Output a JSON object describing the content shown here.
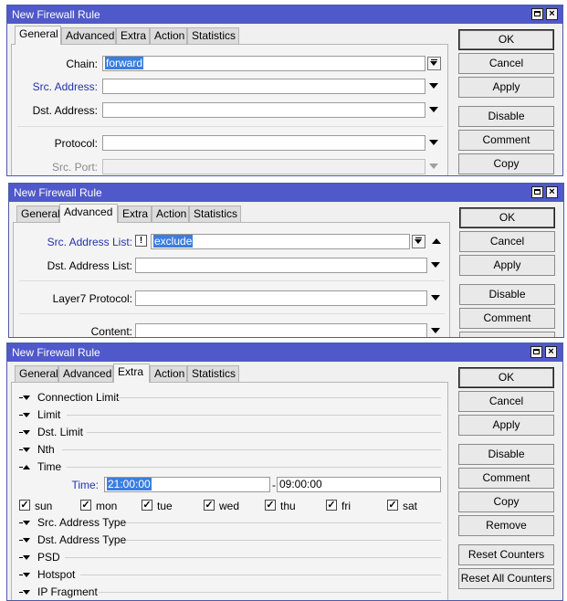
{
  "window1": {
    "title": "New Firewall Rule",
    "tabs": [
      "General",
      "Advanced",
      "Extra",
      "Action",
      "Statistics"
    ],
    "active_tab": "General",
    "fields": {
      "chain_label": "Chain:",
      "chain_value": "forward",
      "src_address_label": "Src. Address:",
      "src_address_value": "",
      "dst_address_label": "Dst. Address:",
      "dst_address_value": "",
      "protocol_label": "Protocol:",
      "protocol_value": "",
      "src_port_label": "Src. Port:",
      "src_port_value": ""
    },
    "buttons": [
      "OK",
      "Cancel",
      "Apply",
      "Disable",
      "Comment",
      "Copy"
    ]
  },
  "window2": {
    "title": "New Firewall Rule",
    "tabs": [
      "General",
      "Advanced",
      "Extra",
      "Action",
      "Statistics"
    ],
    "active_tab": "Advanced",
    "fields": {
      "src_address_list_label": "Src. Address List:",
      "src_address_list_not": "!",
      "src_address_list_value": "exclude",
      "dst_address_list_label": "Dst. Address List:",
      "dst_address_list_value": "",
      "layer7_label": "Layer7 Protocol:",
      "layer7_value": "",
      "content_label": "Content:",
      "content_value": ""
    },
    "buttons": [
      "OK",
      "Cancel",
      "Apply",
      "Disable",
      "Comment"
    ]
  },
  "window3": {
    "title": "New Firewall Rule",
    "tabs": [
      "General",
      "Advanced",
      "Extra",
      "Action",
      "Statistics"
    ],
    "active_tab": "Extra",
    "sections_top": [
      "Connection Limit",
      "Limit",
      "Dst. Limit",
      "Nth"
    ],
    "time_section": "Time",
    "time_label": "Time:",
    "time_from": "21:00:00",
    "time_separator": "-",
    "time_to": "09:00:00",
    "days": [
      {
        "label": "sun",
        "checked": true
      },
      {
        "label": "mon",
        "checked": true
      },
      {
        "label": "tue",
        "checked": true
      },
      {
        "label": "wed",
        "checked": true
      },
      {
        "label": "thu",
        "checked": true
      },
      {
        "label": "fri",
        "checked": true
      },
      {
        "label": "sat",
        "checked": true
      }
    ],
    "check_mark": "✓",
    "sections_bottom": [
      "Src. Address Type",
      "Dst. Address Type",
      "PSD",
      "Hotspot",
      "IP Fragment"
    ],
    "buttons": [
      "OK",
      "Cancel",
      "Apply",
      "Disable",
      "Comment",
      "Copy",
      "Remove",
      "Reset Counters",
      "Reset All Counters"
    ]
  },
  "colors": {
    "titlebar": "#5059c9",
    "selection": "#3a7ee0",
    "blue_label": "#2233aa"
  },
  "icons": {
    "close": "×",
    "maximize": "□"
  }
}
